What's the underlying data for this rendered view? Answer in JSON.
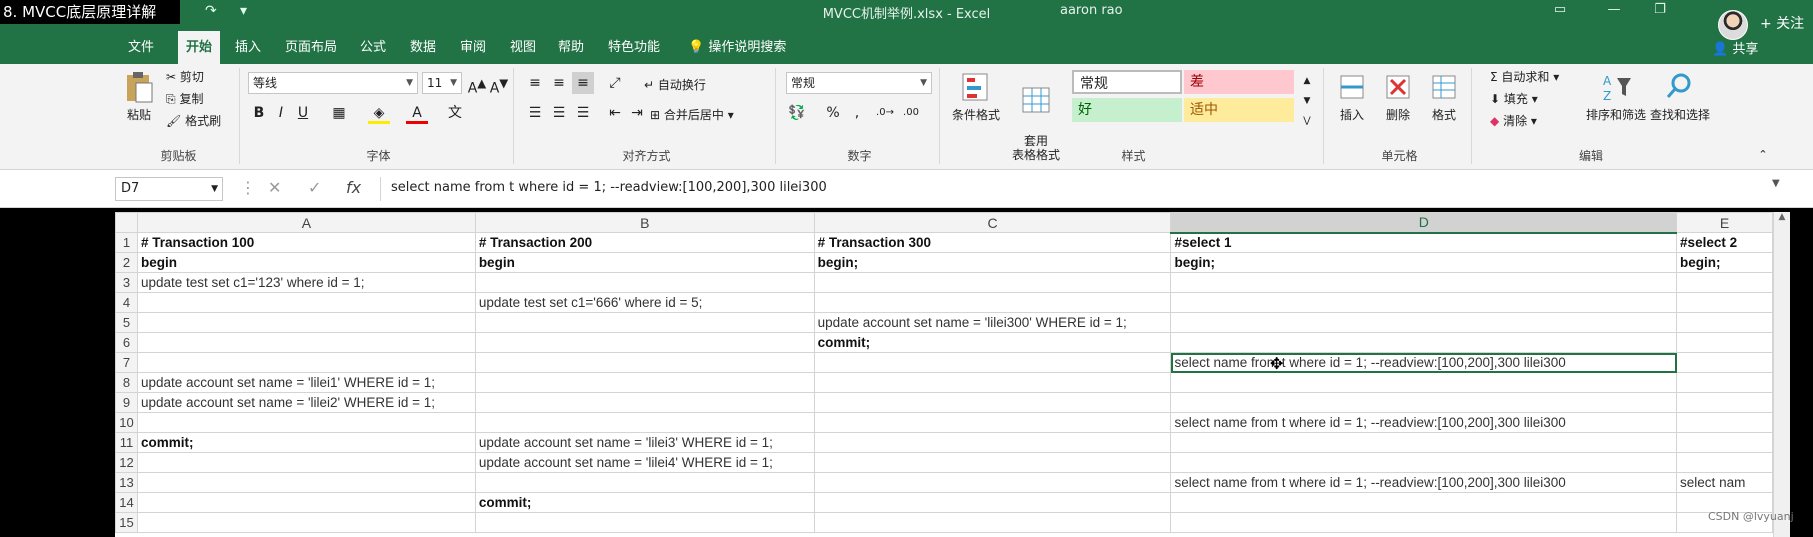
{
  "overlay_title": "8. MVCC底层原理详解",
  "window": {
    "doc_title": "MVCC机制举例.xlsx - Excel",
    "user": "aaron rao",
    "follow_label": "+ 关注",
    "share_label": "共享"
  },
  "tabs": [
    "文件",
    "开始",
    "插入",
    "页面布局",
    "公式",
    "数据",
    "审阅",
    "视图",
    "帮助",
    "特色功能"
  ],
  "active_tab": "开始",
  "help_search": "操作说明搜索",
  "ribbon": {
    "clipboard": {
      "paste": "粘贴",
      "cut": "剪切",
      "copy": "复制",
      "format_painter": "格式刷",
      "label": "剪贴板"
    },
    "font": {
      "name": "等线",
      "size": "11",
      "label": "字体"
    },
    "alignment": {
      "wrap": "自动换行",
      "merge": "合并后居中",
      "label": "对齐方式"
    },
    "number": {
      "format": "常规",
      "label": "数字"
    },
    "styles": {
      "conditional": "条件格式",
      "table_format": "套用\n表格格式",
      "normal": "常规",
      "bad": "差",
      "good": "好",
      "neutral": "适中",
      "label": "样式"
    },
    "cells": {
      "insert": "插入",
      "delete": "删除",
      "format": "格式",
      "label": "单元格"
    },
    "editing": {
      "autosum": "自动求和",
      "fill": "填充",
      "clear": "清除",
      "sort_filter": "排序和筛选",
      "find_select": "查找和选择",
      "label": "编辑"
    }
  },
  "formula_bar": {
    "name_box": "D7",
    "formula": "select name from t where id = 1;  --readview:[100,200],300     lilei300"
  },
  "columns": [
    "A",
    "B",
    "C",
    "D",
    "E"
  ],
  "selected_column": "D",
  "rows": [
    {
      "n": "1",
      "cells": [
        "# Transaction 100",
        "# Transaction 200",
        "# Transaction 300",
        "#select 1",
        "#select 2"
      ],
      "bold": [
        true,
        true,
        true,
        true,
        true
      ]
    },
    {
      "n": "2",
      "cells": [
        "begin",
        "begin",
        "begin;",
        "begin;",
        "begin;"
      ],
      "bold": [
        true,
        true,
        true,
        true,
        true
      ]
    },
    {
      "n": "3",
      "cells": [
        "update test set c1='123' where id = 1;",
        "",
        "",
        "",
        ""
      ],
      "bold": []
    },
    {
      "n": "4",
      "cells": [
        "",
        "update test set c1='666' where id = 5;",
        "",
        "",
        ""
      ],
      "bold": []
    },
    {
      "n": "5",
      "cells": [
        "",
        "",
        "update account set name = 'lilei300' WHERE id = 1;",
        "",
        ""
      ],
      "bold": []
    },
    {
      "n": "6",
      "cells": [
        "",
        "",
        "commit;",
        "",
        ""
      ],
      "bold": [
        false,
        false,
        true,
        false,
        false
      ]
    },
    {
      "n": "7",
      "cells": [
        "",
        "",
        "",
        "select name from t where id = 1;  --readview:[100,200],300     lilei300",
        ""
      ],
      "bold": []
    },
    {
      "n": "8",
      "cells": [
        "update account set name = 'lilei1' WHERE id = 1;",
        "",
        "",
        "",
        ""
      ],
      "bold": []
    },
    {
      "n": "9",
      "cells": [
        "update account set name = 'lilei2' WHERE id = 1;",
        "",
        "",
        "",
        ""
      ],
      "bold": []
    },
    {
      "n": "10",
      "cells": [
        "",
        "",
        "",
        "select name from t where id = 1;  --readview:[100,200],300     lilei300",
        ""
      ],
      "bold": []
    },
    {
      "n": "11",
      "cells": [
        "commit;",
        "update account set name = 'lilei3' WHERE id = 1;",
        "",
        "",
        ""
      ],
      "bold": [
        true,
        false,
        false,
        false,
        false
      ]
    },
    {
      "n": "12",
      "cells": [
        "",
        "update account set name = 'lilei4' WHERE id = 1;",
        "",
        "",
        ""
      ],
      "bold": []
    },
    {
      "n": "13",
      "cells": [
        "",
        "",
        "",
        "select name from t where id = 1;  --readview:[100,200],300     lilei300",
        "select nam"
      ],
      "bold": []
    },
    {
      "n": "14",
      "cells": [
        "",
        "commit;",
        "",
        "",
        ""
      ],
      "bold": [
        false,
        true,
        false,
        false,
        false
      ]
    },
    {
      "n": "15",
      "cells": [
        "",
        "",
        "",
        "",
        ""
      ],
      "bold": []
    }
  ],
  "active_cell": {
    "row": "7",
    "col": "D"
  },
  "watermark": "CSDN @lvyuanj"
}
